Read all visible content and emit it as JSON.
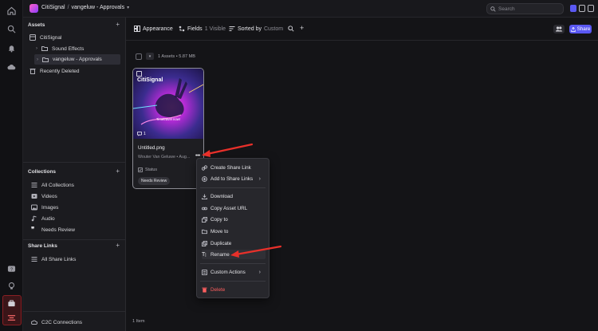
{
  "breadcrumb": {
    "org": "CitiSignal",
    "separator": "/",
    "folder": "vangeluw - Approvals"
  },
  "search": {
    "placeholder": "Search"
  },
  "sidebar": {
    "assets_header": "Assets",
    "tree": [
      {
        "label": "CitiSignal"
      },
      {
        "label": "Sound Effects"
      },
      {
        "label": "vangeluw - Approvals"
      }
    ],
    "recently_deleted": "Recently Deleted",
    "collections_header": "Collections",
    "collections": [
      {
        "label": "All Collections",
        "icon": "list-icon"
      },
      {
        "label": "Videos",
        "icon": "video-icon"
      },
      {
        "label": "Images",
        "icon": "image-icon"
      },
      {
        "label": "Audio",
        "icon": "audio-icon"
      },
      {
        "label": "Needs Review",
        "icon": "quote-icon"
      }
    ],
    "share_links_header": "Share Links",
    "all_share_links": "All Share Links",
    "c2c": "C2C Connections"
  },
  "toolbar": {
    "appearance": "Appearance",
    "fields": "Fields",
    "fields_visible": "1 Visible",
    "sorted_by": "Sorted by",
    "sorted_value": "Custom",
    "share": "Share"
  },
  "summary": {
    "assets": "1 Assets • 5.87 MB"
  },
  "card": {
    "logo": "CitiSignal",
    "tagline": "Timetravel now!",
    "comment_count": "1",
    "filename": "Untitled.png",
    "owner": "Wouter Van Geluwe • Aug...",
    "status_label": "Status",
    "status_value": "Needs Review"
  },
  "footer": {
    "count": "1 Item"
  },
  "menu": {
    "items": [
      {
        "label": "Create Share Link"
      },
      {
        "label": "Add to Share Links"
      },
      {
        "label": "Download"
      },
      {
        "label": "Copy Asset URL"
      },
      {
        "label": "Copy to"
      },
      {
        "label": "Move to"
      },
      {
        "label": "Duplicate"
      },
      {
        "label": "Rename"
      },
      {
        "label": "Custom Actions"
      },
      {
        "label": "Delete"
      }
    ]
  },
  "colors": {
    "accent": "#5a58f2",
    "danger": "#ff5f5f",
    "annotation": "#e8302a"
  }
}
